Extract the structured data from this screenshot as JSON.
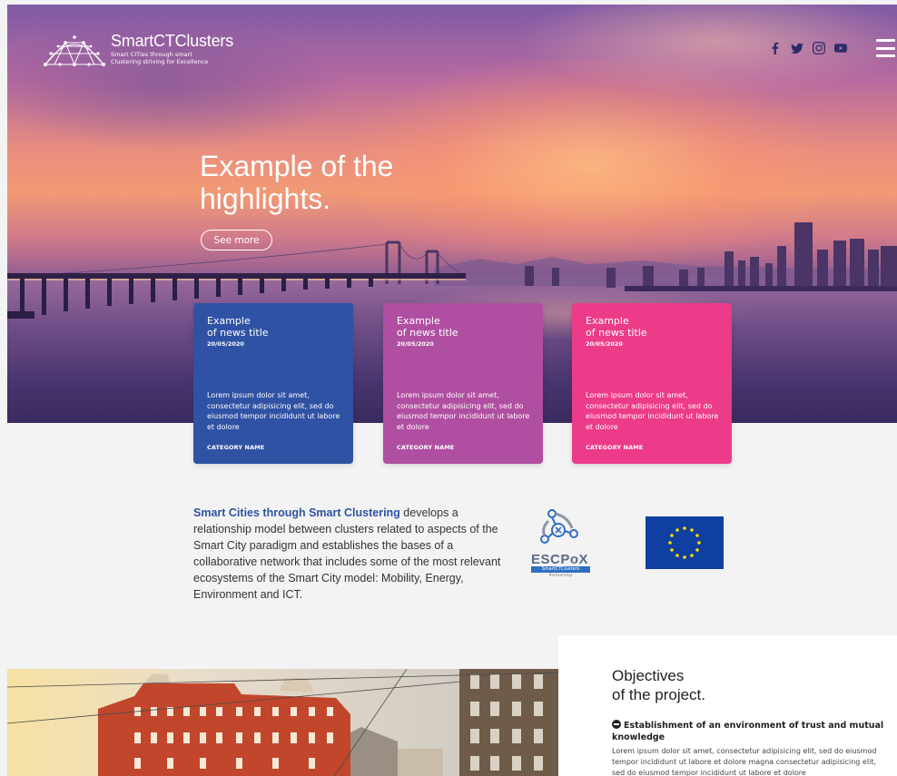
{
  "header": {
    "brand_name": "SmartCTClusters",
    "brand_tagline_line1": "Smart CITies through smart",
    "brand_tagline_line2": "Clustering striving for Excellence",
    "social_icons": [
      "facebook-icon",
      "twitter-icon",
      "instagram-icon",
      "youtube-icon"
    ],
    "menu_icon": "hamburger-menu-icon"
  },
  "hero": {
    "title_line1": "Example of the",
    "title_line2": "highlights.",
    "button_label": "See more"
  },
  "news": [
    {
      "title_line1": "Example",
      "title_line2": "of news title",
      "date": "20/05/2020",
      "text": "Lorem ipsum dolor sit amet, consectetur adipisicing elit, sed do eiusmod tempor incididunt ut labore et dolore",
      "category": "CATEGORY NAME",
      "color": "#2f52a4"
    },
    {
      "title_line1": "Example",
      "title_line2": "of news title",
      "date": "20/05/2020",
      "text": "Lorem ipsum dolor sit amet, consectetur adipisicing elit, sed do eiusmod tempor incididunt ut labore et dolore",
      "category": "CATEGORY NAME",
      "color": "#b04fa1"
    },
    {
      "title_line1": "Example",
      "title_line2": "of news title",
      "date": "20/05/2020",
      "text": "Lorem ipsum dolor sit amet, consectetur adipisicing elit, sed do eiusmod tempor incididunt ut labore et dolore",
      "category": "CATEGORY NAME",
      "color": "#ec3b88"
    }
  ],
  "intro": {
    "highlight": "Smart Cities through Smart Clustering",
    "rest": " develops a relationship model between clusters related to aspects of the Smart City paradigm and establishes the bases of a collaborative network that includes some of the most relevant ecosystems of the Smart City model: Mobility, Energy, Environment and ICT."
  },
  "partners": {
    "escpox_word": "ESCPoX",
    "escpox_bar": "SmartCTClusters",
    "escpox_sub": "Partnership"
  },
  "objectives": {
    "title_line1": "Objectives",
    "title_line2": "of the project.",
    "item_title": "Establishment of an environment of trust and mutual knowledge",
    "item_text": "Lorem ipsum dolor sit amet, consectetur adipisicing elit, sed do eiusmod tempor incididunt ut labore et dolore magna consectetur adipisicing elit, sed do eiusmod tempor incididunt ut labore et dolore"
  },
  "colors": {
    "primary_blue": "#2f52a4",
    "purple": "#b04fa1",
    "pink": "#ec3b88"
  }
}
